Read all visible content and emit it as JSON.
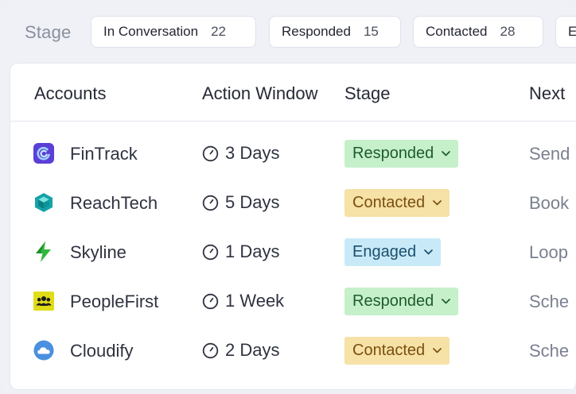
{
  "filter_bar": {
    "label": "Stage",
    "chips": [
      {
        "label": "In Conversation",
        "count": "22"
      },
      {
        "label": "Responded",
        "count": "15"
      },
      {
        "label": "Contacted",
        "count": "28"
      },
      {
        "label": "E",
        "count": ""
      }
    ]
  },
  "table": {
    "headers": {
      "accounts": "Accounts",
      "window": "Action Window",
      "stage": "Stage",
      "next": "Next"
    },
    "rows": [
      {
        "name": "FinTrack",
        "window": "3 Days",
        "stage": "Responded",
        "next": "Send"
      },
      {
        "name": "ReachTech",
        "window": "5 Days",
        "stage": "Contacted",
        "next": "Book"
      },
      {
        "name": "Skyline",
        "window": "1 Days",
        "stage": "Engaged",
        "next": "Loop"
      },
      {
        "name": "PeopleFirst",
        "window": "1 Week",
        "stage": "Responded",
        "next": "Sche"
      },
      {
        "name": "Cloudify",
        "window": "2 Days",
        "stage": "Contacted",
        "next": "Sche"
      }
    ]
  },
  "icons": {
    "logos": [
      "fintrack-logo-icon",
      "reachtech-logo-icon",
      "skyline-logo-icon",
      "peoplefirst-logo-icon",
      "cloudify-logo-icon"
    ],
    "clock": "clock-icon",
    "chevron": "chevron-down-icon"
  },
  "colors": {
    "responded_bg": "#c5f0ca",
    "contacted_bg": "#f6e1a6",
    "engaged_bg": "#c8eaf8",
    "fintrack": "#5b3fd6",
    "reachtech": "#14a3a8",
    "skyline": "#2fb83a",
    "peoplefirst": "#e0dc18",
    "cloudify": "#4a8fe0"
  }
}
